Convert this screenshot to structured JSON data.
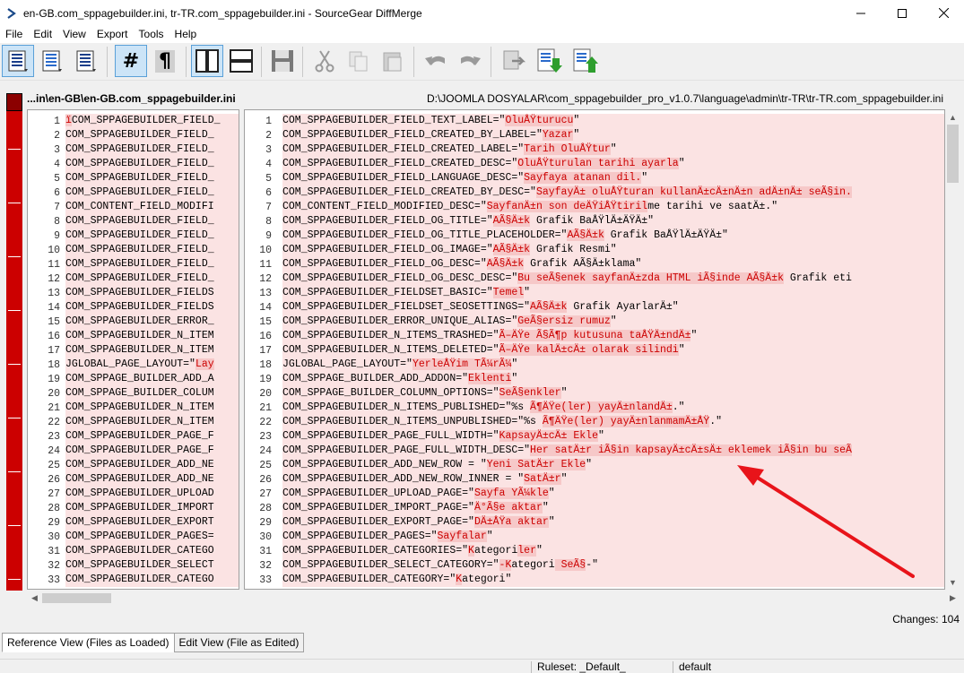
{
  "window": {
    "title": "en-GB.com_sppagebuilder.ini, tr-TR.com_sppagebuilder.ini - SourceGear DiffMerge",
    "minimize": "—",
    "maximize": "☐",
    "close": "✕"
  },
  "menu": [
    "File",
    "Edit",
    "View",
    "Export",
    "Tools",
    "Help"
  ],
  "toolbar": {
    "icons": [
      "view-all-icon",
      "view-changes-icon",
      "view-context-icon",
      "line-numbers-icon",
      "pilcrow-icon",
      "split-vertical-icon",
      "split-horizontal-icon",
      "save-icon",
      "cut-icon",
      "copy-icon",
      "paste-icon",
      "undo-icon",
      "redo-icon",
      "export-icon",
      "next-change-icon",
      "prev-change-icon"
    ],
    "line_numbers_label": "#",
    "pilcrow_label": "¶"
  },
  "paths": {
    "left": "...in\\en-GB\\en-GB.com_sppagebuilder.ini",
    "right": "D:\\JOOMLA DOSYALAR\\com_sppagebuilder_pro_v1.0.7\\language\\admin\\tr-TR\\tr-TR.com_sppagebuilder.ini"
  },
  "left_lines": [
    {
      "n": "1",
      "pre": "",
      "ins": "ï",
      "text": "COM_SPPAGEBUILDER_FIELD_"
    },
    {
      "n": "2",
      "pre": "COM_SPPAGEBUILDER_FIELD_",
      "ins": "",
      "text": ""
    },
    {
      "n": "3",
      "pre": "COM_SPPAGEBUILDER_FIELD_",
      "ins": "",
      "text": ""
    },
    {
      "n": "4",
      "pre": "COM_SPPAGEBUILDER_FIELD_",
      "ins": "",
      "text": ""
    },
    {
      "n": "5",
      "pre": "COM_SPPAGEBUILDER_FIELD_",
      "ins": "",
      "text": ""
    },
    {
      "n": "6",
      "pre": "COM_SPPAGEBUILDER_FIELD_",
      "ins": "",
      "text": ""
    },
    {
      "n": "7",
      "pre": "COM_CONTENT_FIELD_MODIFI",
      "ins": "",
      "text": ""
    },
    {
      "n": "8",
      "pre": "COM_SPPAGEBUILDER_FIELD_",
      "ins": "",
      "text": ""
    },
    {
      "n": "9",
      "pre": "COM_SPPAGEBUILDER_FIELD_",
      "ins": "",
      "text": ""
    },
    {
      "n": "10",
      "pre": "COM_SPPAGEBUILDER_FIELD_",
      "ins": "",
      "text": ""
    },
    {
      "n": "11",
      "pre": "COM_SPPAGEBUILDER_FIELD_",
      "ins": "",
      "text": ""
    },
    {
      "n": "12",
      "pre": "COM_SPPAGEBUILDER_FIELD_",
      "ins": "",
      "text": ""
    },
    {
      "n": "13",
      "pre": "COM_SPPAGEBUILDER_FIELDS",
      "ins": "",
      "text": ""
    },
    {
      "n": "14",
      "pre": "COM_SPPAGEBUILDER_FIELDS",
      "ins": "",
      "text": ""
    },
    {
      "n": "15",
      "pre": "COM_SPPAGEBUILDER_ERROR_",
      "ins": "",
      "text": ""
    },
    {
      "n": "16",
      "pre": "COM_SPPAGEBUILDER_N_ITEM",
      "ins": "",
      "text": ""
    },
    {
      "n": "17",
      "pre": "COM_SPPAGEBUILDER_N_ITEM",
      "ins": "",
      "text": ""
    },
    {
      "n": "18",
      "pre": "JGLOBAL_PAGE_LAYOUT=\"",
      "ins": "Lay",
      "text": ""
    },
    {
      "n": "19",
      "pre": "COM_SPPAGE_BUILDER_ADD_A",
      "ins": "",
      "text": ""
    },
    {
      "n": "20",
      "pre": "COM_SPPAGE_BUILDER_COLUM",
      "ins": "",
      "text": ""
    },
    {
      "n": "21",
      "pre": "COM_SPPAGEBUILDER_N_ITEM",
      "ins": "",
      "text": ""
    },
    {
      "n": "22",
      "pre": "COM_SPPAGEBUILDER_N_ITEM",
      "ins": "",
      "text": ""
    },
    {
      "n": "23",
      "pre": "COM_SPPAGEBUILDER_PAGE_F",
      "ins": "",
      "text": ""
    },
    {
      "n": "24",
      "pre": "COM_SPPAGEBUILDER_PAGE_F",
      "ins": "",
      "text": ""
    },
    {
      "n": "25",
      "pre": "COM_SPPAGEBUILDER_ADD_NE",
      "ins": "",
      "text": ""
    },
    {
      "n": "26",
      "pre": "COM_SPPAGEBUILDER_ADD_NE",
      "ins": "",
      "text": ""
    },
    {
      "n": "27",
      "pre": "COM_SPPAGEBUILDER_UPLOAD",
      "ins": "",
      "text": ""
    },
    {
      "n": "28",
      "pre": "COM_SPPAGEBUILDER_IMPORT",
      "ins": "",
      "text": ""
    },
    {
      "n": "29",
      "pre": "COM_SPPAGEBUILDER_EXPORT",
      "ins": "",
      "text": ""
    },
    {
      "n": "30",
      "pre": "COM_SPPAGEBUILDER_PAGES=",
      "ins": "",
      "text": ""
    },
    {
      "n": "31",
      "pre": "COM_SPPAGEBUILDER_CATEGO",
      "ins": "",
      "text": ""
    },
    {
      "n": "32",
      "pre": "COM_SPPAGEBUILDER_SELECT",
      "ins": "",
      "text": ""
    },
    {
      "n": "33",
      "pre": "COM_SPPAGEBUILDER_CATEGO",
      "ins": "",
      "text": ""
    }
  ],
  "right_lines": [
    {
      "n": "1",
      "pre": "COM_SPPAGEBUILDER_FIELD_TEXT_LABEL=\"",
      "ins": "OluÅŸturucu",
      "post": "\""
    },
    {
      "n": "2",
      "pre": "COM_SPPAGEBUILDER_FIELD_CREATED_BY_LABEL=\"",
      "ins": "Yazar",
      "post": "\""
    },
    {
      "n": "3",
      "pre": "COM_SPPAGEBUILDER_FIELD_CREATED_LABEL=\"",
      "ins": "Tarih OluÅŸtur",
      "post": "\""
    },
    {
      "n": "4",
      "pre": "COM_SPPAGEBUILDER_FIELD_CREATED_DESC=\"",
      "ins": "OluÅŸturulan tarihi ayarla",
      "post": "\""
    },
    {
      "n": "5",
      "pre": "COM_SPPAGEBUILDER_FIELD_LANGUAGE_DESC=\"",
      "ins": "Sayfaya atanan dil.",
      "post": "\""
    },
    {
      "n": "6",
      "pre": "COM_SPPAGEBUILDER_FIELD_CREATED_BY_DESC=\"",
      "ins": "SayfayÄ± oluÅŸturan kullanÄ±cÄ±nÄ±n adÄ±nÄ± seÃ§in.",
      "post": ""
    },
    {
      "n": "7",
      "pre": "COM_CONTENT_FIELD_MODIFIED_DESC=\"",
      "ins": "SayfanÄ±n son deÄŸiÅŸtiril",
      "post": "me tarihi ve saatÄ±.\""
    },
    {
      "n": "8",
      "pre": "COM_SPPAGEBUILDER_FIELD_OG_TITLE=\"",
      "ins": "AÃ§Ä±k",
      "post": " Grafik BaÅŸlÄ±ÄŸÄ±\""
    },
    {
      "n": "9",
      "pre": "COM_SPPAGEBUILDER_FIELD_OG_TITLE_PLACEHOLDER=\"",
      "ins": "AÃ§Ä±k",
      "post": " Grafik BaÅŸlÄ±ÄŸÄ±\""
    },
    {
      "n": "10",
      "pre": "COM_SPPAGEBUILDER_FIELD_OG_IMAGE=\"",
      "ins": "AÃ§Ä±k",
      "post": " Grafik Resmi\""
    },
    {
      "n": "11",
      "pre": "COM_SPPAGEBUILDER_FIELD_OG_DESC=\"",
      "ins": "AÃ§Ä±k",
      "post": " Grafik AÃ§Ä±klama\""
    },
    {
      "n": "12",
      "pre": "COM_SPPAGEBUILDER_FIELD_OG_DESC_DESC=\"",
      "ins": "Bu seÃ§enek sayfanÄ±zda HTML iÃ§inde AÃ§Ä±k",
      "post": " Grafik eti"
    },
    {
      "n": "13",
      "pre": "COM_SPPAGEBUILDER_FIELDSET_BASIC=\"",
      "ins": "Temel",
      "post": "\""
    },
    {
      "n": "14",
      "pre": "COM_SPPAGEBUILDER_FIELDSET_SEOSETTINGS=\"",
      "ins": "AÃ§Ä±k",
      "post": " Grafik AyarlarÄ±\""
    },
    {
      "n": "15",
      "pre": "COM_SPPAGEBUILDER_ERROR_UNIQUE_ALIAS=\"",
      "ins": "GeÃ§ersiz rumuz",
      "post": "\""
    },
    {
      "n": "16",
      "pre": "COM_SPPAGEBUILDER_N_ITEMS_TRASHED=\"",
      "ins": "Ã–ÄŸe Ã§Ã¶p kutusuna taÅŸÄ±ndÄ±",
      "post": "\""
    },
    {
      "n": "17",
      "pre": "COM_SPPAGEBUILDER_N_ITEMS_DELETED=\"",
      "ins": "Ã–ÄŸe kalÄ±cÄ± olarak silindi",
      "post": "\""
    },
    {
      "n": "18",
      "pre": "JGLOBAL_PAGE_LAYOUT=\"",
      "ins": "YerleÅŸim TÃ¼rÃ¼",
      "post": "\""
    },
    {
      "n": "19",
      "pre": "COM_SPPAGE_BUILDER_ADD_ADDON=\"",
      "ins": "Eklenti",
      "post": "\""
    },
    {
      "n": "20",
      "pre": "COM_SPPAGE_BUILDER_COLUMN_OPTIONS=\"",
      "ins": "SeÃ§enkler",
      "post": "\""
    },
    {
      "n": "21",
      "pre": "COM_SPPAGEBUILDER_N_ITEMS_PUBLISHED=\"%s ",
      "ins": "Ã¶ÄŸe(ler) yayÄ±nlandÄ±",
      "post": ".\""
    },
    {
      "n": "22",
      "pre": "COM_SPPAGEBUILDER_N_ITEMS_UNPUBLISHED=\"%s ",
      "ins": "Ã¶ÄŸe(ler) yayÄ±nlanmamÄ±ÅŸ",
      "post": ".\""
    },
    {
      "n": "23",
      "pre": "COM_SPPAGEBUILDER_PAGE_FULL_WIDTH=\"",
      "ins": "KapsayÄ±cÄ± Ekle",
      "post": "\""
    },
    {
      "n": "24",
      "pre": "COM_SPPAGEBUILDER_PAGE_FULL_WIDTH_DESC=\"",
      "ins": "Her satÄ±r iÃ§in kapsayÄ±cÄ±sÄ± eklemek iÃ§in bu seÃ",
      "post": ""
    },
    {
      "n": "25",
      "pre": "COM_SPPAGEBUILDER_ADD_NEW_ROW = \"",
      "ins": "Yeni SatÄ±r Ekle",
      "post": "\""
    },
    {
      "n": "26",
      "pre": "COM_SPPAGEBUILDER_ADD_NEW_ROW_INNER = \"",
      "ins": "SatÄ±r",
      "post": "\""
    },
    {
      "n": "27",
      "pre": "COM_SPPAGEBUILDER_UPLOAD_PAGE=\"",
      "ins": "Sayfa YÃ¼kle",
      "post": "\""
    },
    {
      "n": "28",
      "pre": "COM_SPPAGEBUILDER_IMPORT_PAGE=\"",
      "ins": "Ä°Ã§e aktar",
      "post": "\""
    },
    {
      "n": "29",
      "pre": "COM_SPPAGEBUILDER_EXPORT_PAGE=\"",
      "ins": "DÄ±ÅŸa aktar",
      "post": "\""
    },
    {
      "n": "30",
      "pre": "COM_SPPAGEBUILDER_PAGES=\"",
      "ins": "Sayfalar",
      "post": "\""
    },
    {
      "n": "31",
      "pre": "COM_SPPAGEBUILDER_CATEGORIES=\"",
      "ins": "K",
      "post": "ategori",
      "ins2": "ler",
      "post2": "\""
    },
    {
      "n": "32",
      "pre": "COM_SPPAGEBUILDER_SELECT_CATEGORY=\"",
      "ins": "-K",
      "post": "ategori",
      "ins2": " SeÃ§",
      "post2": "-\""
    },
    {
      "n": "33",
      "pre": "COM_SPPAGEBUILDER_CATEGORY=\"",
      "ins": "K",
      "post": "ategori",
      "ins2": "",
      "post2": "\""
    }
  ],
  "status": {
    "changes": "Changes: 104",
    "ruleset": "Ruleset: _Default_",
    "default": "default"
  },
  "tabs": [
    {
      "label": "Reference View (Files as Loaded)"
    },
    {
      "label": "Edit View (File as Edited)"
    }
  ],
  "colors": {
    "diff_bg": "#fbe3e3",
    "diff_ins_bg": "#f6c8c8",
    "diff_ins_text": "#cc0000",
    "overview": "#cc0000",
    "annotation_arrow": "#e8141a"
  }
}
